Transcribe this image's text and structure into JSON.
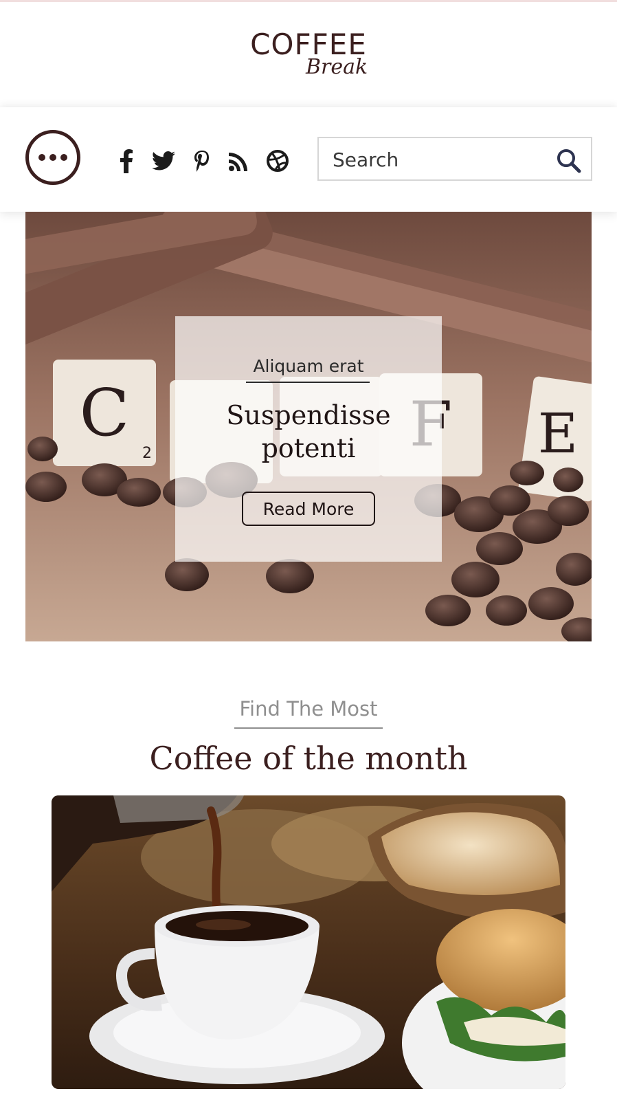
{
  "logo": {
    "main": "COFFEE",
    "sub": "Break"
  },
  "nav": {
    "menu_icon": "ellipsis-circle-icon",
    "social": [
      "facebook-icon",
      "twitter-icon",
      "pinterest-icon",
      "rss-icon",
      "dribbble-icon"
    ],
    "search": {
      "placeholder": "Search",
      "icon": "search-icon"
    }
  },
  "hero": {
    "image": "coffee-scrabble-tiles-and-beans-photo",
    "kicker": "Aliquam erat",
    "title_line1": "Suspendisse",
    "title_line2": "potenti",
    "button_label": "Read More"
  },
  "section": {
    "kicker": "Find The Most",
    "title": "Coffee of the month",
    "image": "coffee-pouring-with-bread-photo"
  },
  "colors": {
    "brand": "#3b1f1f",
    "muted": "#8f8f8f",
    "border": "#d6d6d6"
  }
}
